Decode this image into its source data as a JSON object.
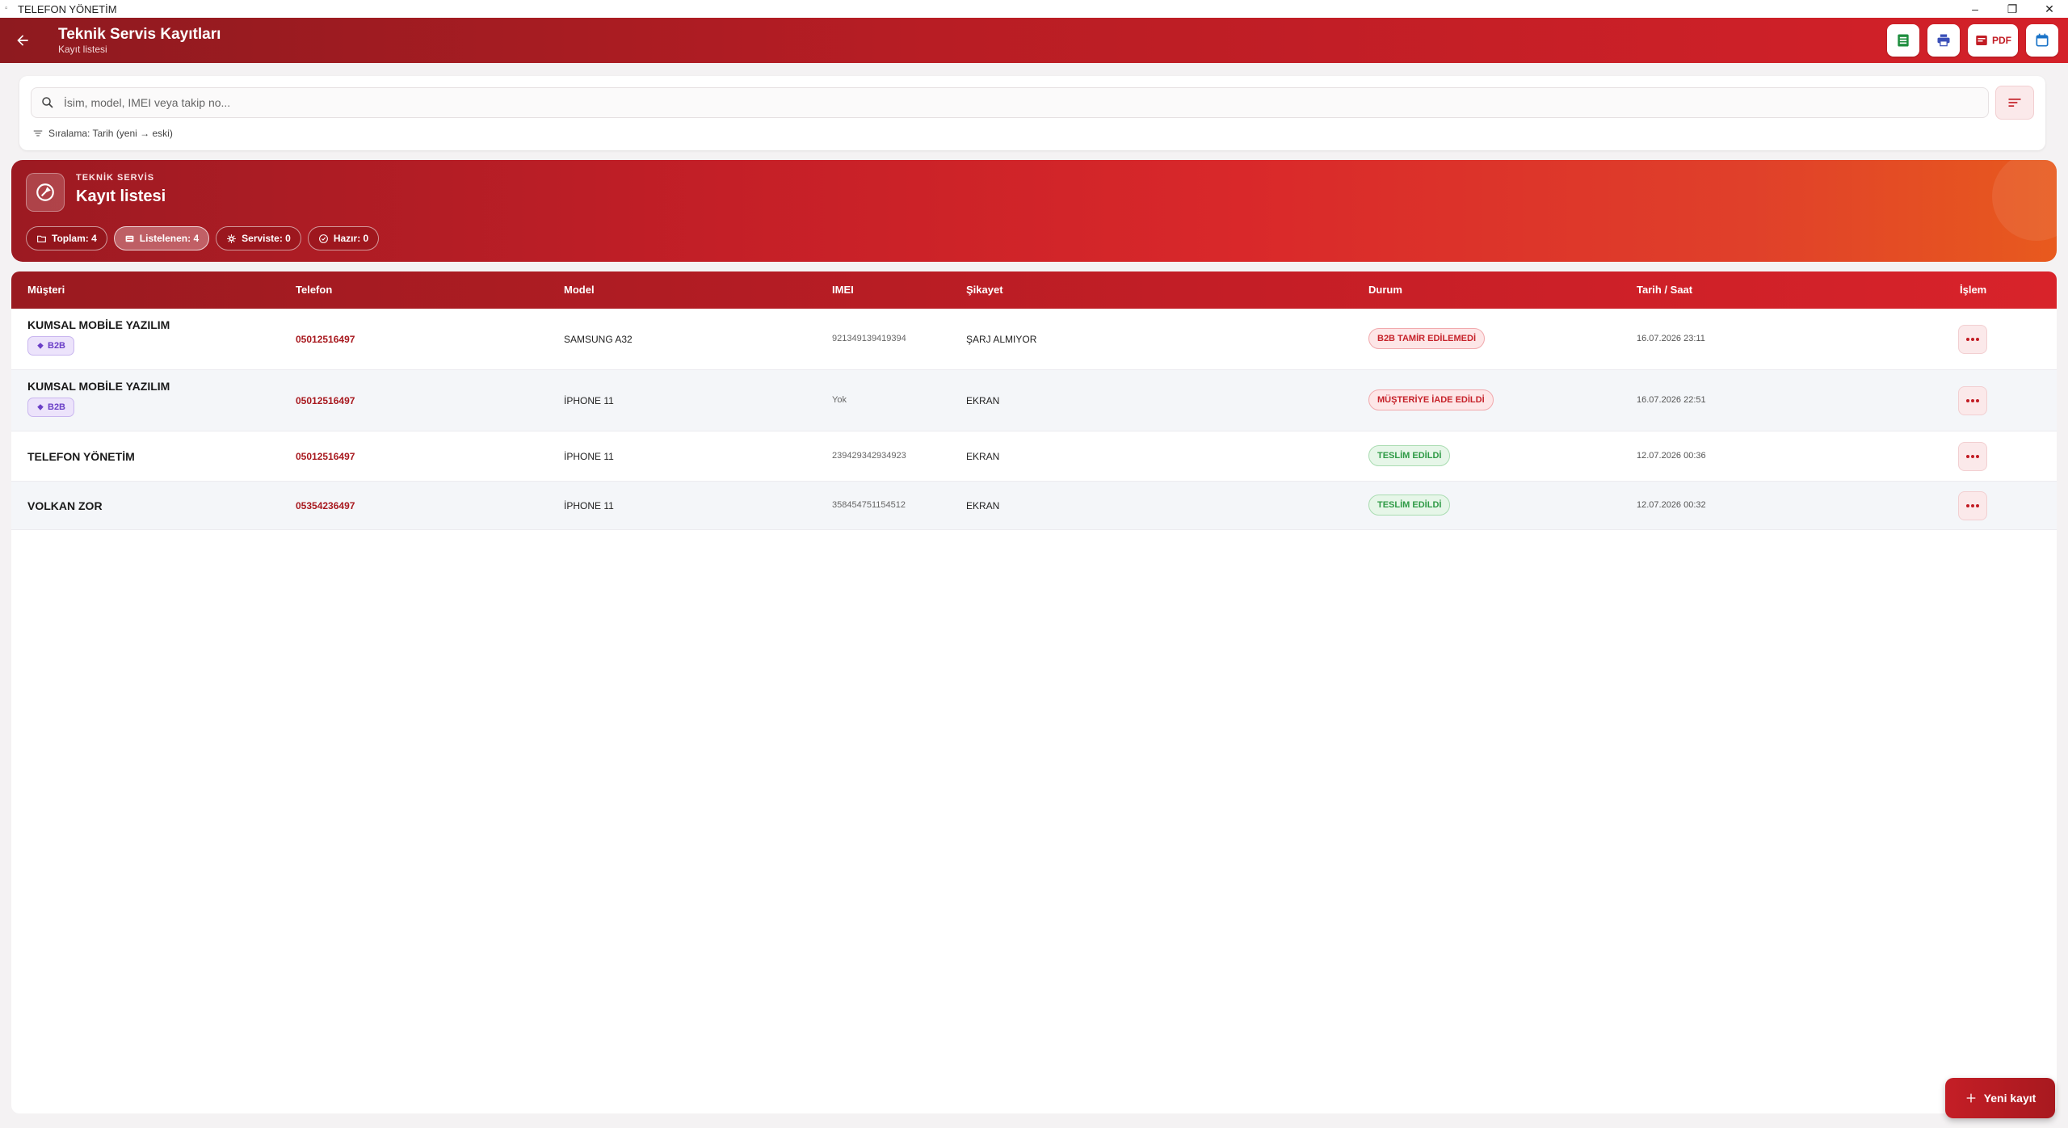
{
  "window": {
    "title": "TELEFON YÖNETİM"
  },
  "header": {
    "title": "Teknik Servis Kayıtları",
    "subtitle": "Kayıt listesi",
    "pdf_label": "PDF"
  },
  "search": {
    "placeholder": "İsim, model, IMEI veya takip no...",
    "sort_text": "Sıralama: Tarih (yeni → eski)"
  },
  "hero": {
    "kicker": "TEKNİK SERVİS",
    "title": "Kayıt listesi",
    "chips": [
      {
        "label": "Toplam: 4"
      },
      {
        "label": "Listelenen: 4"
      },
      {
        "label": "Serviste: 0"
      },
      {
        "label": "Hazır: 0"
      }
    ]
  },
  "table": {
    "headers": [
      "Müşteri",
      "Telefon",
      "Model",
      "IMEI",
      "Şikayet",
      "Durum",
      "Tarih / Saat",
      "İşlem"
    ],
    "rows": [
      {
        "customer": "KUMSAL MOBİLE YAZILIM",
        "badge": "B2B",
        "phone": "05012516497",
        "model": "SAMSUNG A32",
        "imei": "921349139419394",
        "complaint": "ŞARJ ALMIYOR",
        "status": "B2B TAMİR EDİLEMEDİ",
        "status_color": "#c6222a",
        "datetime": "16.07.2026 23:11"
      },
      {
        "customer": "KUMSAL MOBİLE YAZILIM",
        "badge": "B2B",
        "phone": "05012516497",
        "model": "İPHONE 11",
        "imei": "Yok",
        "complaint": "EKRAN",
        "status": "MÜŞTERİYE İADE EDİLDİ",
        "status_color": "#c6222a",
        "datetime": "16.07.2026 22:51"
      },
      {
        "customer": "TELEFON YÖNETİM",
        "badge": "",
        "phone": "05012516497",
        "model": "İPHONE 11",
        "imei": "239429342934923",
        "complaint": "EKRAN",
        "status": "TESLİM EDİLDİ",
        "status_color": "#2e9a45",
        "datetime": "12.07.2026 00:36"
      },
      {
        "customer": "VOLKAN ZOR",
        "badge": "",
        "phone": "05354236497",
        "model": "İPHONE 11",
        "imei": "358454751154512",
        "complaint": "EKRAN",
        "status": "TESLİM EDİLDİ",
        "status_color": "#2e9a45",
        "datetime": "12.07.2026 00:32"
      }
    ]
  },
  "fab": {
    "label": "Yeni kayıt"
  },
  "colors": {
    "brand": "#c41e26",
    "brand_dark": "#8e1a1f",
    "b2b": "#6b3fc7",
    "success": "#2e9a45"
  }
}
